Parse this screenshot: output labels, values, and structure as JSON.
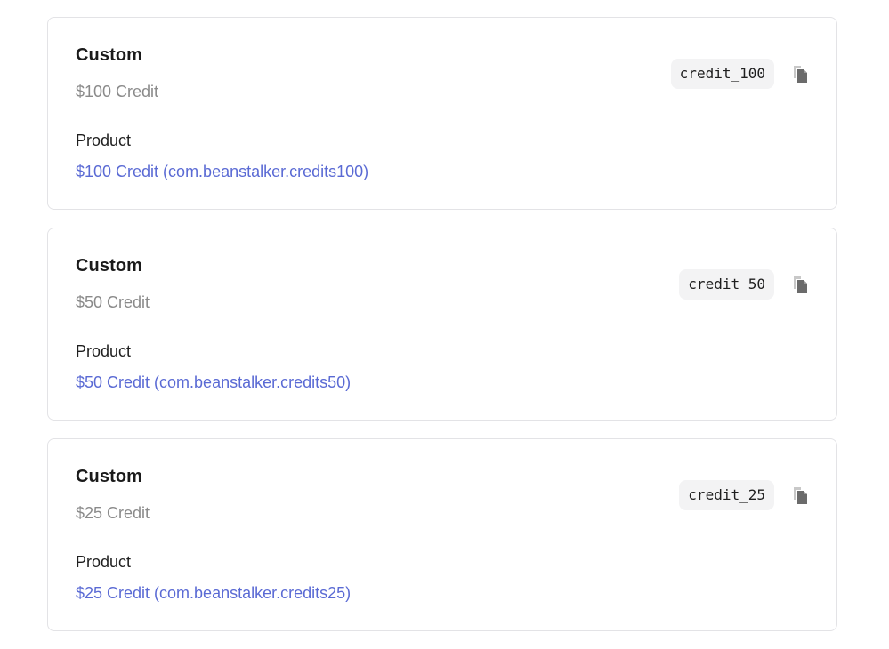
{
  "items": [
    {
      "type": "Custom",
      "subtitle": "$100 Credit",
      "product_label": "Product",
      "product_link": "$100 Credit (com.beanstalker.credits100)",
      "code": "credit_100"
    },
    {
      "type": "Custom",
      "subtitle": "$50 Credit",
      "product_label": "Product",
      "product_link": "$50 Credit (com.beanstalker.credits50)",
      "code": "credit_50"
    },
    {
      "type": "Custom",
      "subtitle": "$25 Credit",
      "product_label": "Product",
      "product_link": "$25 Credit (com.beanstalker.credits25)",
      "code": "credit_25"
    }
  ],
  "icons": {
    "copy": "copy-icon"
  },
  "colors": {
    "link": "#5a6ad4",
    "muted_text": "#8a8a8a",
    "border": "#e3e3e6",
    "chip_background": "#f3f3f4"
  }
}
